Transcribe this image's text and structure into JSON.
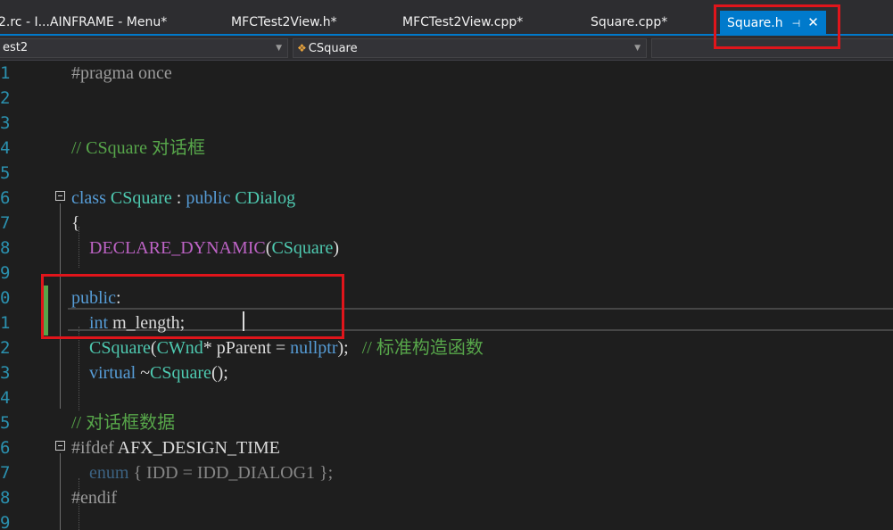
{
  "tabs": [
    {
      "label": "2.rc - I...AINFRAME - Menu*",
      "active": false
    },
    {
      "label": "MFCTest2View.h*",
      "active": false
    },
    {
      "label": "MFCTest2View.cpp*",
      "active": false
    },
    {
      "label": "Square.cpp*",
      "active": false
    },
    {
      "label": "Square.h",
      "active": true
    }
  ],
  "tab_pin_glyph": "⊣",
  "tab_close_glyph": "✕",
  "nav": {
    "project": "est2",
    "class_scope": "CSquare",
    "member_scope": ""
  },
  "line_numbers": [
    "1",
    "2",
    "3",
    "4",
    "5",
    "6",
    "7",
    "8",
    "9",
    "0",
    "1",
    "2",
    "3",
    "4",
    "5",
    "6",
    "7",
    "8",
    "9"
  ],
  "code": {
    "l1_pp": "#pragma once",
    "l4_comment": "// CSquare 对话框",
    "l6_kw_class": "class",
    "l6_name": "CSquare",
    "l6_colon": " : ",
    "l6_kw_public": "public",
    "l6_base": "CDialog",
    "l7_brace": "{",
    "l8_macro": "DECLARE_DYNAMIC",
    "l8_open": "(",
    "l8_arg": "CSquare",
    "l8_close": ")",
    "l10_kw": "public",
    "l10_colon": ":",
    "l11_type": "int",
    "l11_rest": " m_length;",
    "l12_ctor": "CSquare",
    "l12_open": "(",
    "l12_type": "CWnd",
    "l12_ptr": "* pParent = ",
    "l12_null": "nullptr",
    "l12_end": ");   ",
    "l12_comment": "// 标准构造函数",
    "l13_kw": "virtual",
    "l13_dtor": " ~",
    "l13_name": "CSquare",
    "l13_end": "();",
    "l15_comment": "// 对话框数据",
    "l16_pp": "#ifdef",
    "l16_macro": " AFX_DESIGN_TIME",
    "l17_kw": "enum",
    "l17_rest": " { IDD = IDD_DIALOG1 };",
    "l18_pp": "#endif"
  },
  "colors": {
    "highlight_box": "#e0151b",
    "active_tab": "#007acc",
    "change_bar": "#57a64a"
  }
}
